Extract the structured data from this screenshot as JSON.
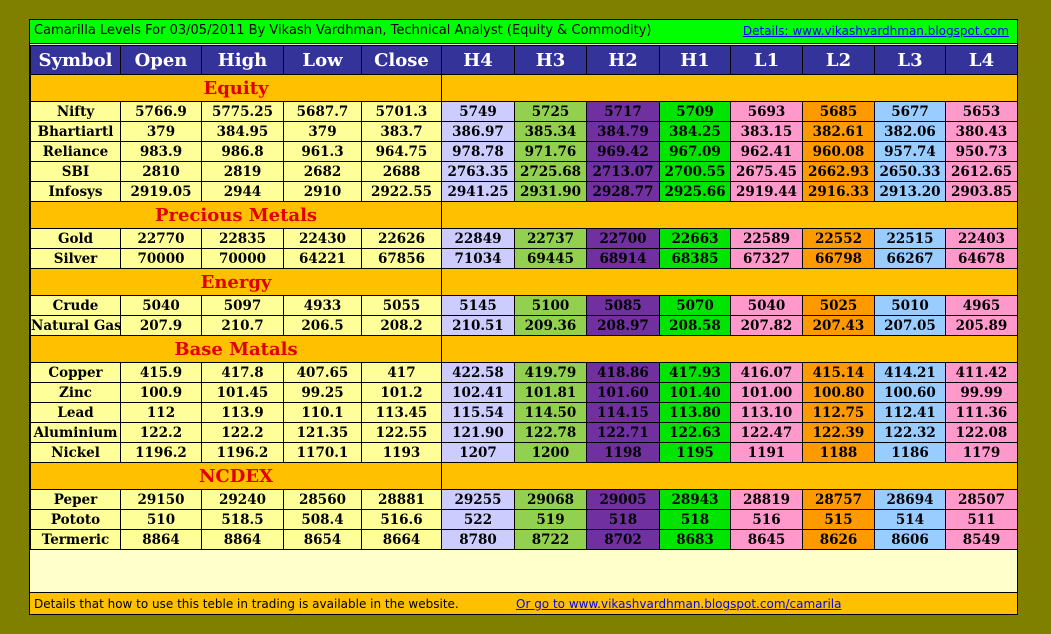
{
  "title": "Camarilla Levels For 03/05/2011 By Vikash Vardhman, Technical Analyst (Equity & Commodity)",
  "details_link": "Details: www.vikashvardhman.blogspot.com",
  "headers": [
    "Symbol",
    "Open",
    "High",
    "Low",
    "Close",
    "H4",
    "H3",
    "H2",
    "H1",
    "L1",
    "L2",
    "L3",
    "L4"
  ],
  "sections": [
    {
      "name": "Equity",
      "rows": [
        [
          "Nifty",
          "5766.9",
          "5775.25",
          "5687.7",
          "5701.3",
          "5749",
          "5725",
          "5717",
          "5709",
          "5693",
          "5685",
          "5677",
          "5653"
        ],
        [
          "Bhartiartl",
          "379",
          "384.95",
          "379",
          "383.7",
          "386.97",
          "385.34",
          "384.79",
          "384.25",
          "383.15",
          "382.61",
          "382.06",
          "380.43"
        ],
        [
          "Reliance",
          "983.9",
          "986.8",
          "961.3",
          "964.75",
          "978.78",
          "971.76",
          "969.42",
          "967.09",
          "962.41",
          "960.08",
          "957.74",
          "950.73"
        ],
        [
          "SBI",
          "2810",
          "2819",
          "2682",
          "2688",
          "2763.35",
          "2725.68",
          "2713.07",
          "2700.55",
          "2675.45",
          "2662.93",
          "2650.33",
          "2612.65"
        ],
        [
          "Infosys",
          "2919.05",
          "2944",
          "2910",
          "2922.55",
          "2941.25",
          "2931.90",
          "2928.77",
          "2925.66",
          "2919.44",
          "2916.33",
          "2913.20",
          "2903.85"
        ]
      ]
    },
    {
      "name": "Precious Metals",
      "rows": [
        [
          "Gold",
          "22770",
          "22835",
          "22430",
          "22626",
          "22849",
          "22737",
          "22700",
          "22663",
          "22589",
          "22552",
          "22515",
          "22403"
        ],
        [
          "Silver",
          "70000",
          "70000",
          "64221",
          "67856",
          "71034",
          "69445",
          "68914",
          "68385",
          "67327",
          "66798",
          "66267",
          "64678"
        ]
      ]
    },
    {
      "name": "Energy",
      "rows": [
        [
          "Crude",
          "5040",
          "5097",
          "4933",
          "5055",
          "5145",
          "5100",
          "5085",
          "5070",
          "5040",
          "5025",
          "5010",
          "4965"
        ],
        [
          "Natural Gas",
          "207.9",
          "210.7",
          "206.5",
          "208.2",
          "210.51",
          "209.36",
          "208.97",
          "208.58",
          "207.82",
          "207.43",
          "207.05",
          "205.89"
        ]
      ]
    },
    {
      "name": "Base Matals",
      "rows": [
        [
          "Copper",
          "415.9",
          "417.8",
          "407.65",
          "417",
          "422.58",
          "419.79",
          "418.86",
          "417.93",
          "416.07",
          "415.14",
          "414.21",
          "411.42"
        ],
        [
          "Zinc",
          "100.9",
          "101.45",
          "99.25",
          "101.2",
          "102.41",
          "101.81",
          "101.60",
          "101.40",
          "101.00",
          "100.80",
          "100.60",
          "99.99"
        ],
        [
          "Lead",
          "112",
          "113.9",
          "110.1",
          "113.45",
          "115.54",
          "114.50",
          "114.15",
          "113.80",
          "113.10",
          "112.75",
          "112.41",
          "111.36"
        ],
        [
          "Aluminium",
          "122.2",
          "122.2",
          "121.35",
          "122.55",
          "121.90",
          "122.78",
          "122.71",
          "122.63",
          "122.47",
          "122.39",
          "122.32",
          "122.08"
        ],
        [
          "Nickel",
          "1196.2",
          "1196.2",
          "1170.1",
          "1193",
          "1207",
          "1200",
          "1198",
          "1195",
          "1191",
          "1188",
          "1186",
          "1179"
        ]
      ]
    },
    {
      "name": "NCDEX",
      "rows": [
        [
          "Peper",
          "29150",
          "29240",
          "28560",
          "28881",
          "29255",
          "29068",
          "29005",
          "28943",
          "28819",
          "28757",
          "28694",
          "28507"
        ],
        [
          "Pototo",
          "510",
          "518.5",
          "508.4",
          "516.6",
          "522",
          "519",
          "518",
          "518",
          "516",
          "515",
          "514",
          "511"
        ],
        [
          "Termeric",
          "8864",
          "8864",
          "8654",
          "8664",
          "8780",
          "8722",
          "8702",
          "8683",
          "8645",
          "8626",
          "8606",
          "8549"
        ]
      ]
    }
  ],
  "footer_note": "Details that how to use this teble in trading is available in the website.",
  "footer_link": "Or go to www.vikashvardhman.blogspot.com/camarila",
  "colors": {
    "background": "#7f7f00",
    "title_bar": "#00ff00",
    "header": "#333399",
    "section": "#ffc000",
    "base": "#ffff99",
    "H4": "#ccccff",
    "H3": "#92d050",
    "H2": "#7030a0",
    "H1": "#00e400",
    "L1": "#ff99cc",
    "L2": "#ff9900",
    "L3": "#99ccff",
    "L4": "#ff99cc"
  }
}
